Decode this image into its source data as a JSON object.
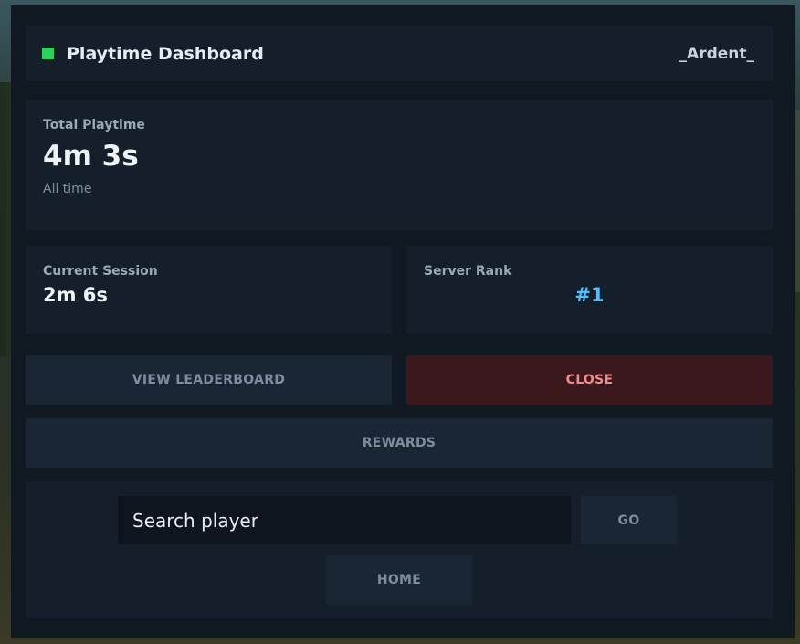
{
  "header": {
    "title": "Playtime Dashboard",
    "username": "_Ardent_",
    "status_color": "#2fd15a"
  },
  "total_playtime": {
    "label": "Total Playtime",
    "value": "4m 3s",
    "subtitle": "All time"
  },
  "current_session": {
    "label": "Current Session",
    "value": "2m 6s"
  },
  "server_rank": {
    "label": "Server Rank",
    "value": "#1",
    "color": "#4cc3ff"
  },
  "buttons": {
    "view_leaderboard": "VIEW LEADERBOARD",
    "close": "CLOSE",
    "rewards": "REWARDS",
    "go": "GO",
    "home": "HOME"
  },
  "search": {
    "placeholder": "Search player",
    "value": ""
  }
}
